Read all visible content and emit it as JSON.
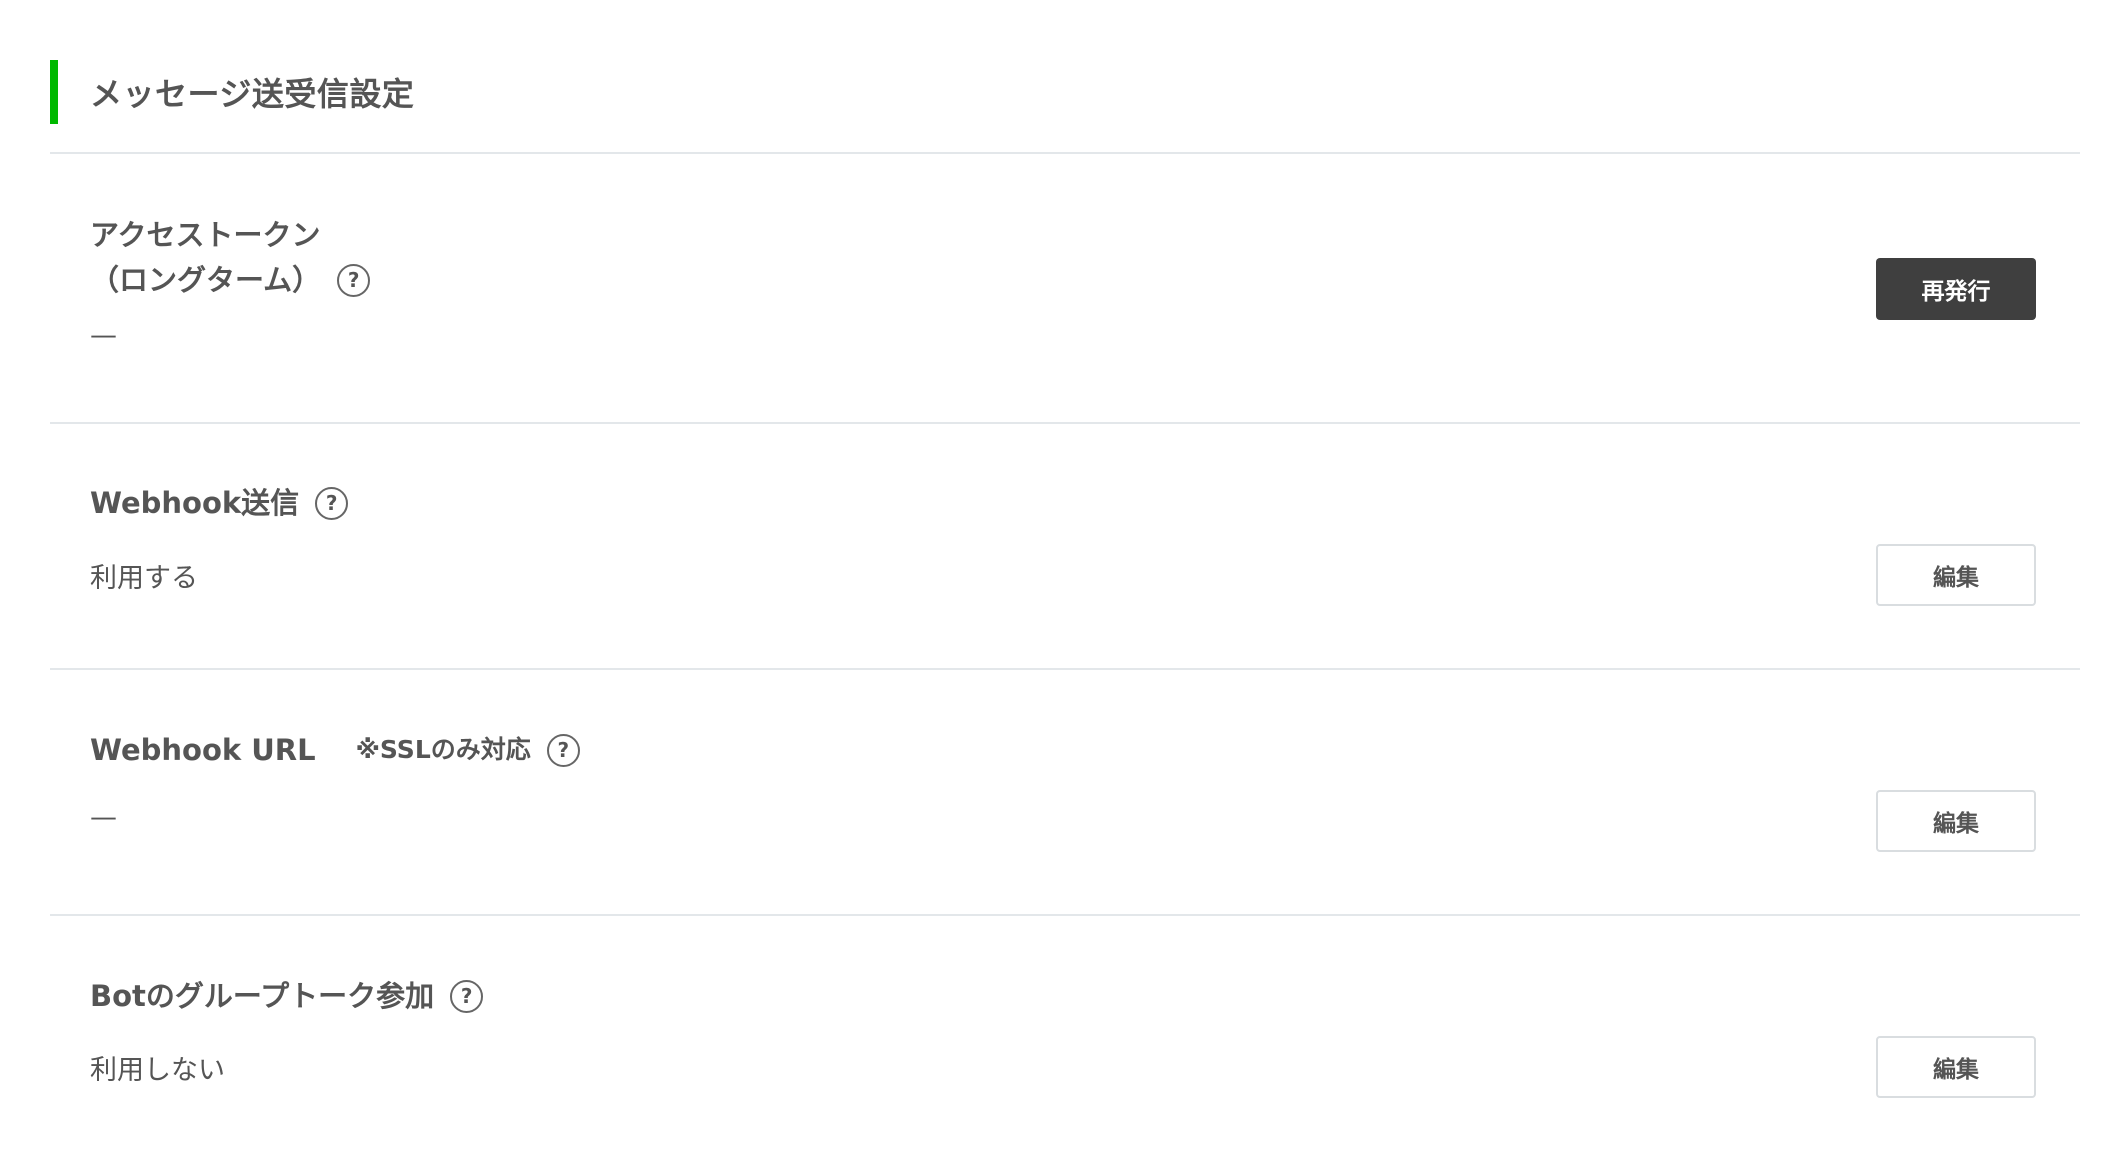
{
  "section": {
    "title": "メッセージ送受信設定",
    "accent_color": "#00b900"
  },
  "rows": [
    {
      "title_line1": "アクセストークン",
      "title_line2": "（ロングターム）",
      "value": "—",
      "button": "再発行"
    },
    {
      "title": "Webhook送信",
      "value": "利用する",
      "button": "編集"
    },
    {
      "title": "Webhook URL",
      "note": "※SSLのみ対応",
      "value": "—",
      "button": "編集"
    },
    {
      "title": "Botのグループトーク参加",
      "value": "利用しない",
      "button": "編集"
    }
  ],
  "help_icon": "?"
}
